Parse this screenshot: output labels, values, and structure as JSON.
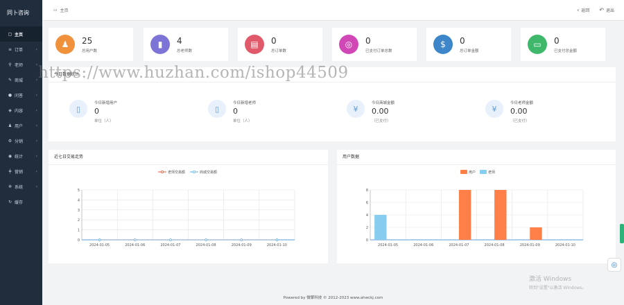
{
  "brand": "同卜咨询",
  "sidebar": {
    "items": [
      {
        "label": "主页",
        "icon": "▢",
        "chev": ""
      },
      {
        "label": "订单",
        "icon": "≡",
        "chev": "‹"
      },
      {
        "label": "老师",
        "icon": "⚲",
        "chev": "‹"
      },
      {
        "label": "商城",
        "icon": "✎",
        "chev": "‹"
      },
      {
        "label": "问答",
        "icon": "●",
        "chev": "‹"
      },
      {
        "label": "内容",
        "icon": "◈",
        "chev": "‹"
      },
      {
        "label": "用户",
        "icon": "♟",
        "chev": "‹"
      },
      {
        "label": "分销",
        "icon": "⚙",
        "chev": "‹"
      },
      {
        "label": "统计",
        "icon": "◉",
        "chev": "‹"
      },
      {
        "label": "营销",
        "icon": "╪",
        "chev": "‹"
      },
      {
        "label": "系统",
        "icon": "✲",
        "chev": "‹"
      },
      {
        "label": "缓存",
        "icon": "↻",
        "chev": ""
      }
    ]
  },
  "topbar": {
    "crumb": "主页",
    "back": "返回",
    "exit": "退出"
  },
  "stats": [
    {
      "value": "25",
      "label": "总用户数",
      "color": "#f0913c",
      "icon": "♟"
    },
    {
      "value": "4",
      "label": "总老师数",
      "color": "#7c74d6",
      "icon": "▮"
    },
    {
      "value": "0",
      "label": "总订单数",
      "color": "#e05a6c",
      "icon": "▤"
    },
    {
      "value": "0",
      "label": "已支付订单总数",
      "color": "#d147b5",
      "icon": "◎"
    },
    {
      "value": "0",
      "label": "总订单金额",
      "color": "#3c86c9",
      "icon": "$"
    },
    {
      "value": "0",
      "label": "已支付总金额",
      "color": "#3fb86b",
      "icon": "▭"
    }
  ],
  "today": {
    "title": "今日数据统计",
    "items": [
      {
        "label": "今日新增用户",
        "value": "0",
        "unit": "单位（人）",
        "icon": "▯"
      },
      {
        "label": "今日新增老师",
        "value": "0",
        "unit": "单位（人）",
        "icon": "▯"
      },
      {
        "label": "今日商城金额",
        "value": "0.00",
        "unit": "（已支付）",
        "icon": "¥"
      },
      {
        "label": "今日老师金额",
        "value": "0.00",
        "unit": "（已支付）",
        "icon": "¥"
      }
    ]
  },
  "chart_data": [
    {
      "type": "line",
      "title": "近七日交易走势",
      "x": [
        "2024-01-05",
        "2024-01-06",
        "2024-01-07",
        "2024-01-08",
        "2024-01-09",
        "2024-01-10"
      ],
      "series": [
        {
          "name": "老师交易额",
          "values": [
            0,
            0,
            0,
            0,
            0,
            0
          ],
          "color": "#f05a3c"
        },
        {
          "name": "商城交易额",
          "values": [
            0,
            0,
            0,
            0,
            0,
            0
          ],
          "color": "#5fb4e8"
        }
      ],
      "ylim": [
        0,
        5
      ],
      "yticks": [
        "0",
        "1",
        "2",
        "3",
        "4",
        "5"
      ],
      "legend": "top-center"
    },
    {
      "type": "bar",
      "title": "用户数据",
      "categories": [
        "2024-01-05",
        "2024-01-06",
        "2024-01-07",
        "2024-01-08",
        "2024-01-09",
        "2024-01-10"
      ],
      "series": [
        {
          "name": "用户",
          "values": [
            0,
            0,
            8,
            8,
            2,
            0
          ],
          "color": "#ff7f48"
        },
        {
          "name": "老师",
          "values": [
            4,
            0,
            0,
            0,
            0,
            0
          ],
          "color": "#86cdf0"
        }
      ],
      "ylim": [
        0,
        8
      ],
      "yticks": [
        "0",
        "2",
        "4",
        "6",
        "8"
      ],
      "legend": "top-center"
    }
  ],
  "watermark": "https://www.huzhan.com/ishop44509",
  "windows": {
    "line1": "激活 Windows",
    "line2": "转到\"设置\"以激活 Windows。"
  },
  "footer": "Powered by 微擎科技 © 2012-2023 www.ahwckj.com"
}
